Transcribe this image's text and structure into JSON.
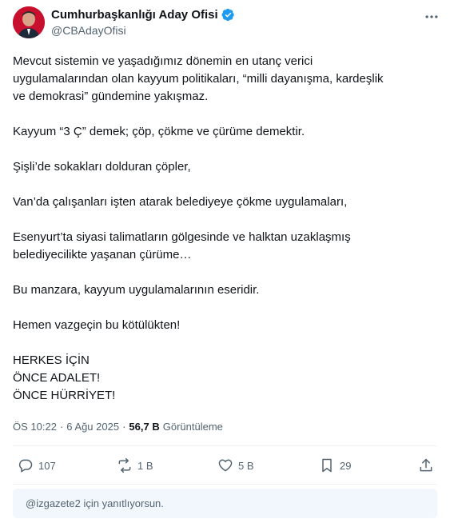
{
  "author": {
    "display_name": "Cumhurbaşkanlığı Aday Ofisi",
    "handle": "@CBAdayOfisi",
    "verified_color": "#1d9bf0"
  },
  "tweet": {
    "paragraphs": [
      [
        "Mevcut sistemin ve yaşadığımız dönemin en utanç verici",
        "uygulamalarından olan kayyum politikaları, “milli dayanışma, kardeşlik",
        "ve demokrasi” gündemine yakışmaz."
      ],
      [
        "Kayyum  “3 Ç” demek; çöp, çökme ve çürüme demektir."
      ],
      [
        "Şişli’de sokakları dolduran çöpler,"
      ],
      [
        "Van’da çalışanları işten atarak belediyeye çökme uygulamaları,"
      ],
      [
        "Esenyurt’ta siyasi talimatların gölgesinde ve halktan uzaklaşmış",
        "belediyecilikte yaşanan çürüme…"
      ],
      [
        "Bu manzara, kayyum uygulamalarının eseridir."
      ],
      [
        "Hemen vazgeçin bu kötülükten!"
      ],
      [
        "HERKES İÇİN",
        "ÖNCE ADALET!",
        "ÖNCE HÜRRİYET!"
      ]
    ]
  },
  "meta": {
    "time": "ÖS 10:22",
    "separator": "·",
    "date": "6 Ağu 2025",
    "views_count": "56,7 B",
    "views_label": "Görüntüleme"
  },
  "actions": {
    "replies": "107",
    "reposts": "1 B",
    "likes": "5 B",
    "bookmarks": "29"
  },
  "reply_banner": "@izgazete2 için yanıtlıyorsun.",
  "icons": {
    "more": "more-horizontal-icon",
    "reply": "reply-icon",
    "repost": "repost-icon",
    "like": "heart-icon",
    "bookmark": "bookmark-icon",
    "share": "share-icon",
    "verified": "verified-badge-icon"
  }
}
